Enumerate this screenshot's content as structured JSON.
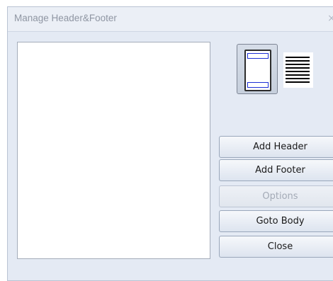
{
  "window": {
    "title": "Manage Header&Footer",
    "close_glyph": "×"
  },
  "list": {
    "items": []
  },
  "mode_icons": [
    {
      "icon": "header-footer-page-icon",
      "selected": true
    },
    {
      "icon": "body-text-lines-icon",
      "selected": false
    }
  ],
  "buttons": {
    "add_header": "Add Header",
    "add_footer": "Add Footer",
    "options": "Options",
    "goto_body": "Goto Body",
    "close": "Close"
  }
}
